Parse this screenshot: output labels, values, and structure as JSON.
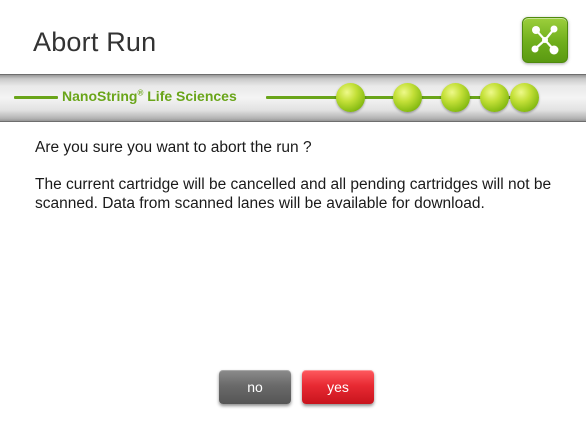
{
  "dialog": {
    "title": "Abort Run",
    "app_icon": "network-nodes-icon",
    "accent_color": "#6aa51a"
  },
  "banner": {
    "brand_name": "NanoString",
    "brand_mark": "®",
    "brand_suffix": " Life Sciences",
    "progress_dots": 5
  },
  "message": {
    "question": "Are you sure you want to abort the run ?",
    "details": "The current cartridge will be cancelled and all pending cartridges will not be scanned.  Data from scanned lanes will be available for download."
  },
  "buttons": {
    "no_label": "no",
    "yes_label": "yes",
    "no_color": "#6a6a6a",
    "yes_color": "#e82a33"
  }
}
